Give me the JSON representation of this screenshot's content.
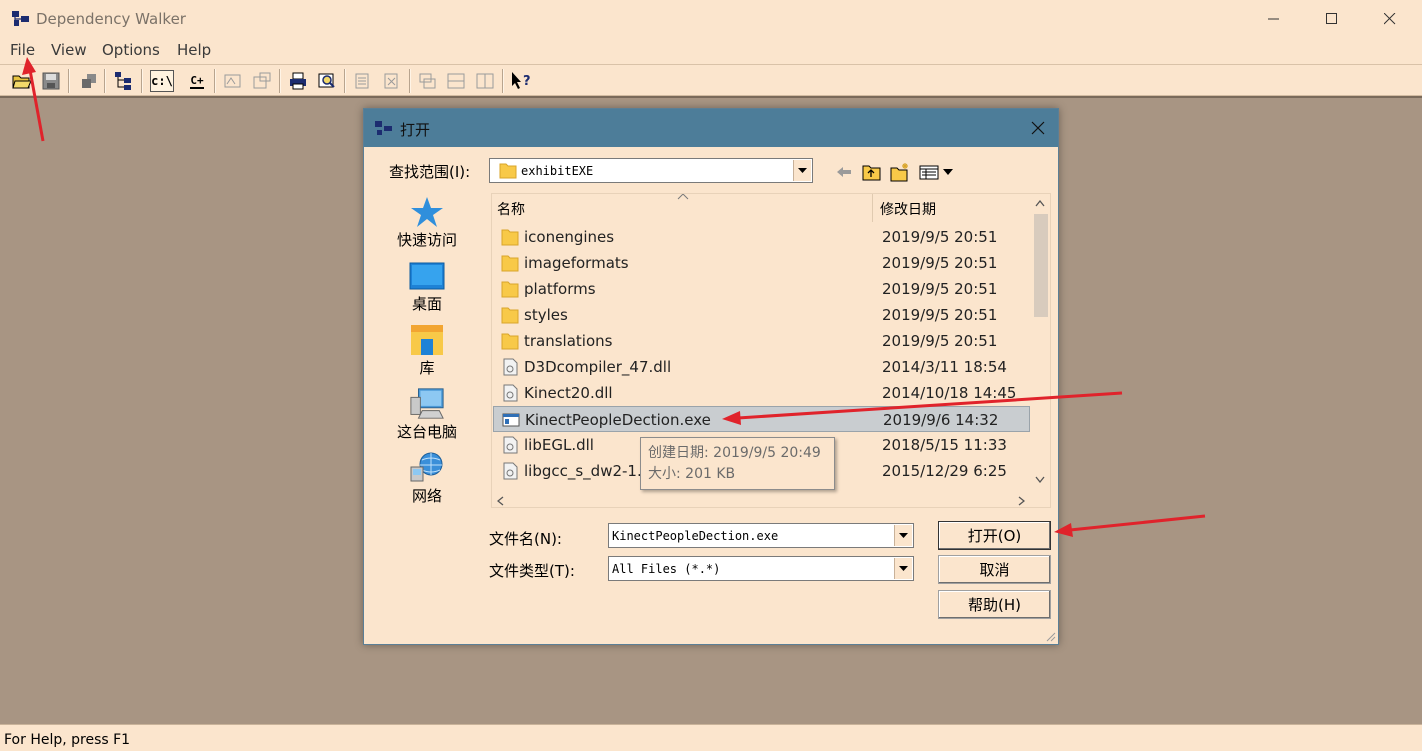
{
  "window": {
    "title": "Dependency Walker"
  },
  "menu": {
    "file": "File",
    "view": "View",
    "options": "Options",
    "help": "Help"
  },
  "toolbar": {
    "icons": [
      "open-icon",
      "save-icon",
      "copy-icon",
      "module-tree-icon",
      "full-paths-icon",
      "cpp-icon",
      "properties-icon",
      "view-module-icon",
      "print-icon",
      "find-icon",
      "expand-icon",
      "collapse-icon",
      "cascade-icon",
      "tile-horizontal-icon",
      "tile-vertical-icon",
      "context-help-icon"
    ],
    "fullpaths_label": "c:\\",
    "cpp_label": "C+"
  },
  "status": {
    "text": "For Help, press F1"
  },
  "dialog": {
    "title": "打开",
    "look_in_label": "查找范围(I):",
    "look_in_value": "exhibitEXE",
    "places": [
      {
        "label": "快速访问",
        "icon": "quick-access-star-icon"
      },
      {
        "label": "桌面",
        "icon": "desktop-icon"
      },
      {
        "label": "库",
        "icon": "library-icon"
      },
      {
        "label": "这台电脑",
        "icon": "computer-icon"
      },
      {
        "label": "网络",
        "icon": "network-icon"
      }
    ],
    "columns": {
      "name": "名称",
      "date": "修改日期"
    },
    "files": [
      {
        "name": "iconengines",
        "date": "2019/9/5 20:51",
        "type": "folder"
      },
      {
        "name": "imageformats",
        "date": "2019/9/5 20:51",
        "type": "folder"
      },
      {
        "name": "platforms",
        "date": "2019/9/5 20:51",
        "type": "folder"
      },
      {
        "name": "styles",
        "date": "2019/9/5 20:51",
        "type": "folder"
      },
      {
        "name": "translations",
        "date": "2019/9/5 20:51",
        "type": "folder"
      },
      {
        "name": "D3Dcompiler_47.dll",
        "date": "2014/3/11 18:54",
        "type": "dll"
      },
      {
        "name": "Kinect20.dll",
        "date": "2014/10/18 14:45",
        "type": "dll"
      },
      {
        "name": "KinectPeopleDection.exe",
        "date": "2019/9/6 14:32",
        "type": "exe"
      },
      {
        "name": "libEGL.dll",
        "date": "2018/5/15 11:33",
        "type": "dll"
      },
      {
        "name": "libgcc_s_dw2-1.dll",
        "date": "2015/12/29 6:25",
        "type": "dll"
      }
    ],
    "selected_index": 7,
    "tooltip": {
      "created": "创建日期: 2019/9/5 20:49",
      "size": "大小: 201 KB"
    },
    "filename_label": "文件名(N):",
    "filename_value": "KinectPeopleDection.exe",
    "filetype_label": "文件类型(T):",
    "filetype_value": "All Files (*.*)",
    "open_button": "打开(O)",
    "cancel_button": "取消",
    "help_button": "帮助(H)"
  },
  "colors": {
    "dialog_title_bar": "#4d7d99",
    "workspace": "#a89583",
    "window_bg": "#fbe5cd",
    "annotation_arrow": "#e0232b",
    "selection": "#c9cdd0"
  }
}
